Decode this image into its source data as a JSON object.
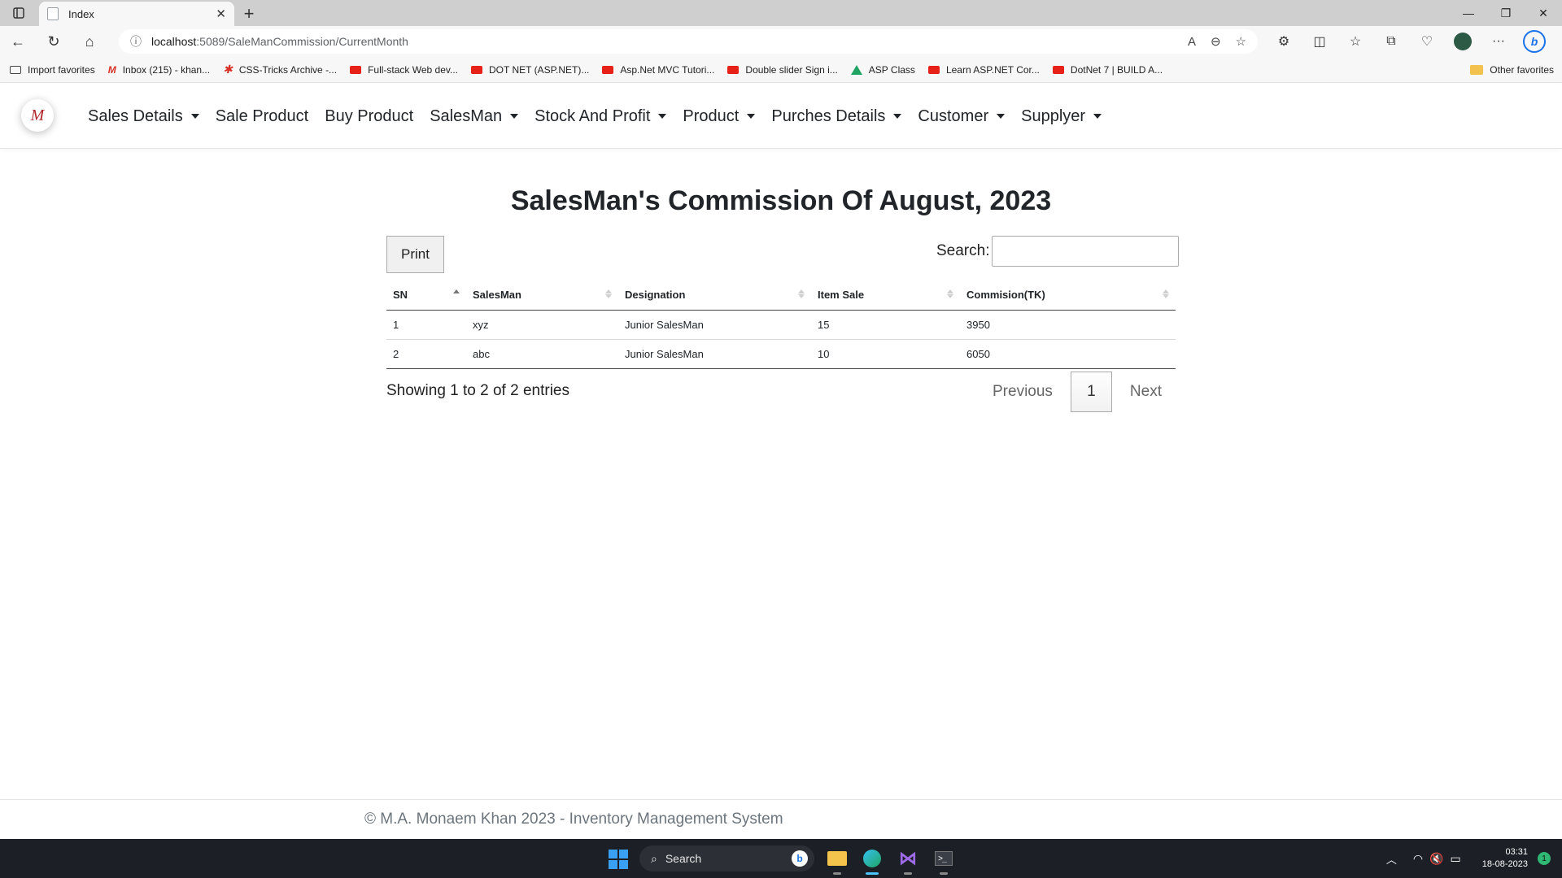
{
  "browser": {
    "tab_title": "Index",
    "url_host": "localhost",
    "url_path": ":5089/SaleManCommission/CurrentMonth",
    "favorites": [
      {
        "label": "Import favorites",
        "icon": "import-icon"
      },
      {
        "label": "Inbox (215) - khan...",
        "icon": "gmail-icon"
      },
      {
        "label": "CSS-Tricks Archive -...",
        "icon": "css-tricks-icon"
      },
      {
        "label": "Full-stack Web dev...",
        "icon": "youtube-icon"
      },
      {
        "label": "DOT NET (ASP.NET)...",
        "icon": "youtube-icon"
      },
      {
        "label": "Asp.Net MVC Tutori...",
        "icon": "youtube-icon"
      },
      {
        "label": "Double slider Sign i...",
        "icon": "youtube-icon"
      },
      {
        "label": "ASP Class",
        "icon": "drive-icon"
      },
      {
        "label": "Learn ASP.NET Cor...",
        "icon": "youtube-icon"
      },
      {
        "label": "DotNet 7 | BUILD A...",
        "icon": "youtube-icon"
      }
    ],
    "other_favorites": "Other favorites"
  },
  "navbar": {
    "logo_text": "M",
    "items": [
      {
        "label": "Sales Details",
        "dropdown": true
      },
      {
        "label": "Sale Product",
        "dropdown": false
      },
      {
        "label": "Buy Product",
        "dropdown": false
      },
      {
        "label": "SalesMan",
        "dropdown": true
      },
      {
        "label": "Stock And Profit",
        "dropdown": true
      },
      {
        "label": "Product",
        "dropdown": true
      },
      {
        "label": "Purches Details",
        "dropdown": true
      },
      {
        "label": "Customer",
        "dropdown": true
      },
      {
        "label": "Supplyer",
        "dropdown": true
      }
    ]
  },
  "main": {
    "title": "SalesMan's Commission Of August, 2023",
    "print_label": "Print",
    "search_label": "Search:",
    "search_value": "",
    "table": {
      "columns": [
        "SN",
        "SalesMan",
        "Designation",
        "Item Sale",
        "Commision(TK)"
      ],
      "rows": [
        [
          "1",
          "xyz",
          "Junior SalesMan",
          "15",
          "3950"
        ],
        [
          "2",
          "abc",
          "Junior SalesMan",
          "10",
          "6050"
        ]
      ]
    },
    "info": "Showing 1 to 2 of 2 entries",
    "pagination": {
      "previous": "Previous",
      "current": "1",
      "next": "Next"
    }
  },
  "footer": {
    "text": "© M.A. Monaem Khan 2023 - Inventory Management System"
  },
  "taskbar": {
    "search_placeholder": "Search",
    "time": "03:31",
    "date": "18-08-2023",
    "notification_count": "1"
  },
  "colors": {
    "logo": "#b0282d",
    "taskbar": "#1c1f26",
    "accent": "#1b72e8"
  }
}
